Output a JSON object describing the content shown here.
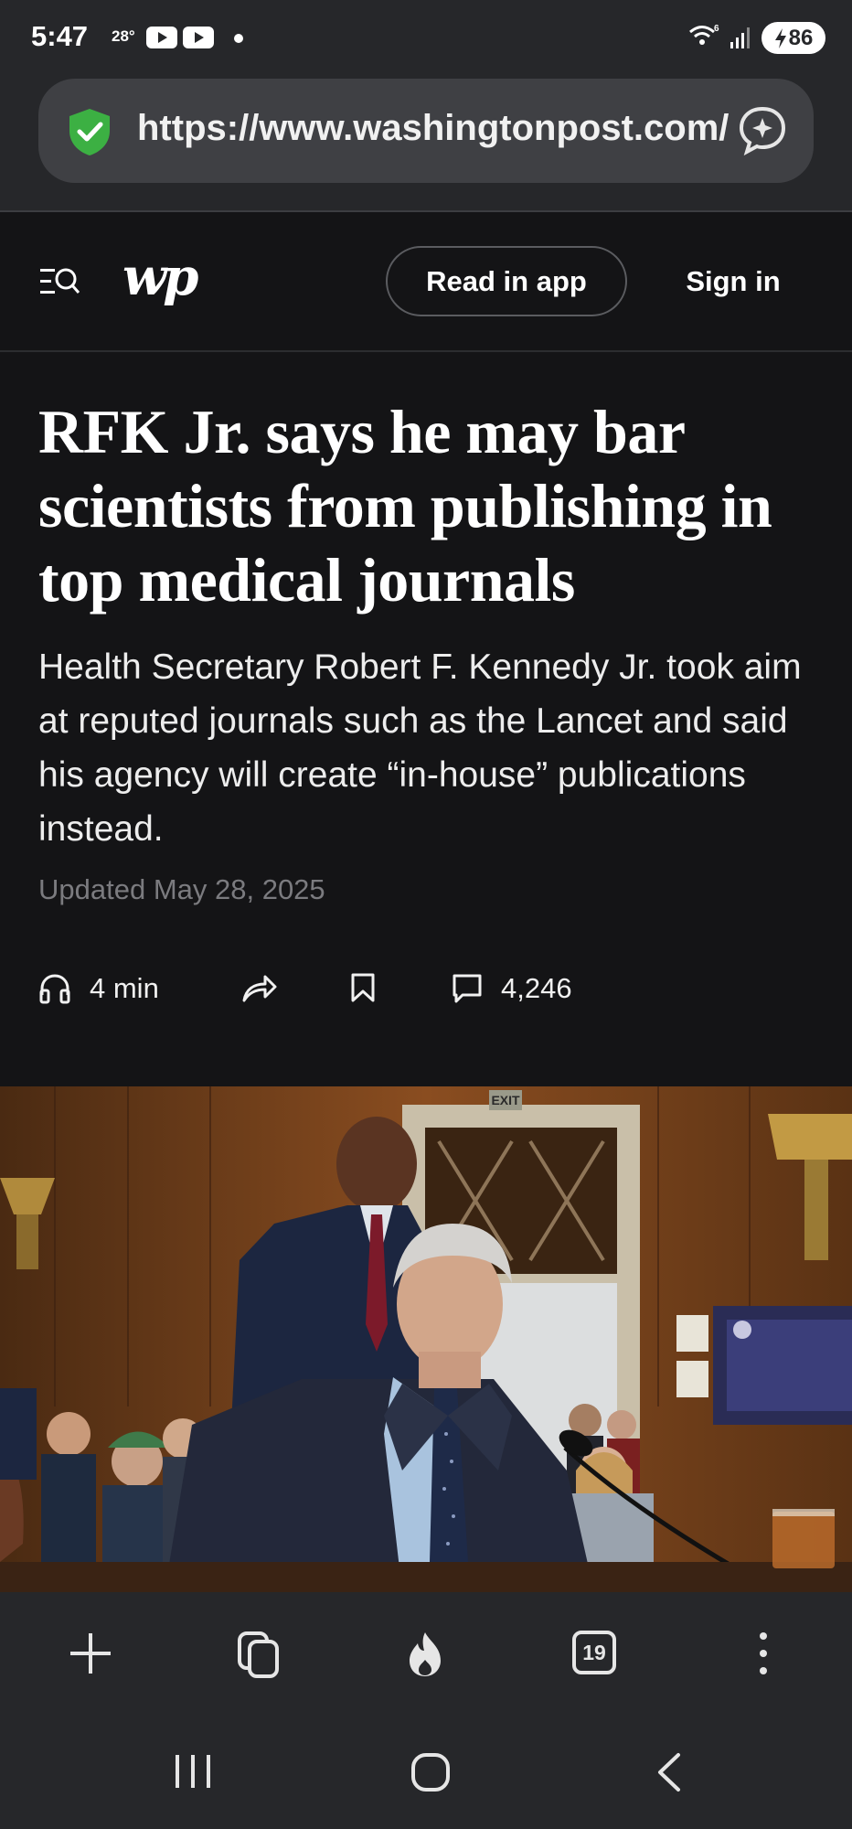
{
  "status_bar": {
    "time": "5:47",
    "temperature": "28°",
    "battery": "86",
    "wifi_label": "6"
  },
  "browser": {
    "url": "https://www.washingtonpost.com/",
    "open_tabs": "19"
  },
  "site_header": {
    "logo": "wp",
    "read_in_app": "Read in app",
    "sign_in": "Sign in"
  },
  "article": {
    "headline": "RFK Jr. says he may bar scientists from publishing in top medical journals",
    "dek": "Health Secretary Robert F. Kennedy Jr. took aim at reputed journals such as the Lancet and said his agency will create “in-house” publications instead.",
    "updated": "Updated May 28, 2025",
    "listen_time": "4 min",
    "comment_count": "4,246",
    "photo_sign": "EXIT"
  },
  "colors": {
    "page_bg": "#141416",
    "chrome_bg": "#26272a",
    "shield_green": "#3cb043"
  }
}
